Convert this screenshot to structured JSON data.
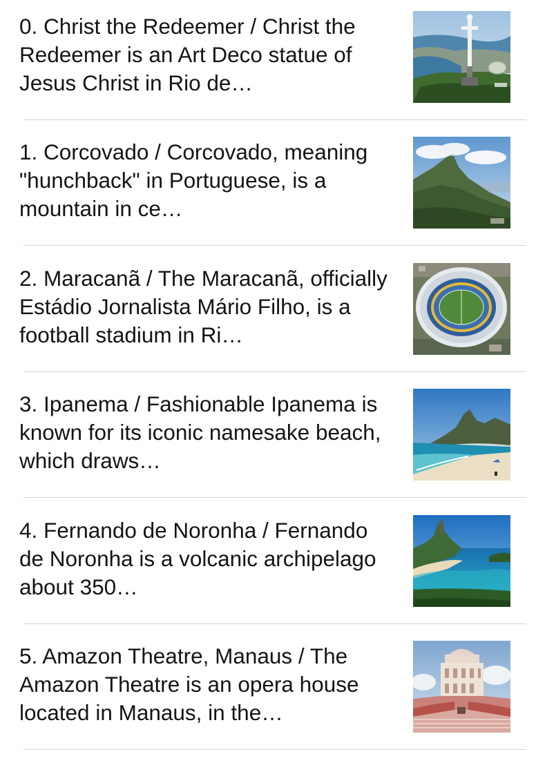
{
  "list": {
    "items": [
      {
        "text": "0. Christ the Redeemer / Christ the Redeemer is an Art Deco statue of Jesus Christ in Rio de…",
        "thumbnail": "christ-the-redeemer-photo"
      },
      {
        "text": "1. Corcovado / Corcovado, meaning \"hunchback\" in Portuguese, is a mountain in ce…",
        "thumbnail": "corcovado-photo"
      },
      {
        "text": "2. Maracanã / The Maracanã, officially Estádio Jornalista Mário Filho, is a football stadium in Ri…",
        "thumbnail": "maracana-photo"
      },
      {
        "text": "3. Ipanema / Fashionable Ipanema is known for its iconic namesake beach, which draws…",
        "thumbnail": "ipanema-photo"
      },
      {
        "text": "4. Fernando de Noronha / Fernando de Noronha is a volcanic archipelago about 350…",
        "thumbnail": "fernando-de-noronha-photo"
      },
      {
        "text": "5. Amazon Theatre, Manaus / The Amazon Theatre is an opera house located in Manaus, in the…",
        "thumbnail": "amazon-theatre-photo"
      }
    ]
  }
}
